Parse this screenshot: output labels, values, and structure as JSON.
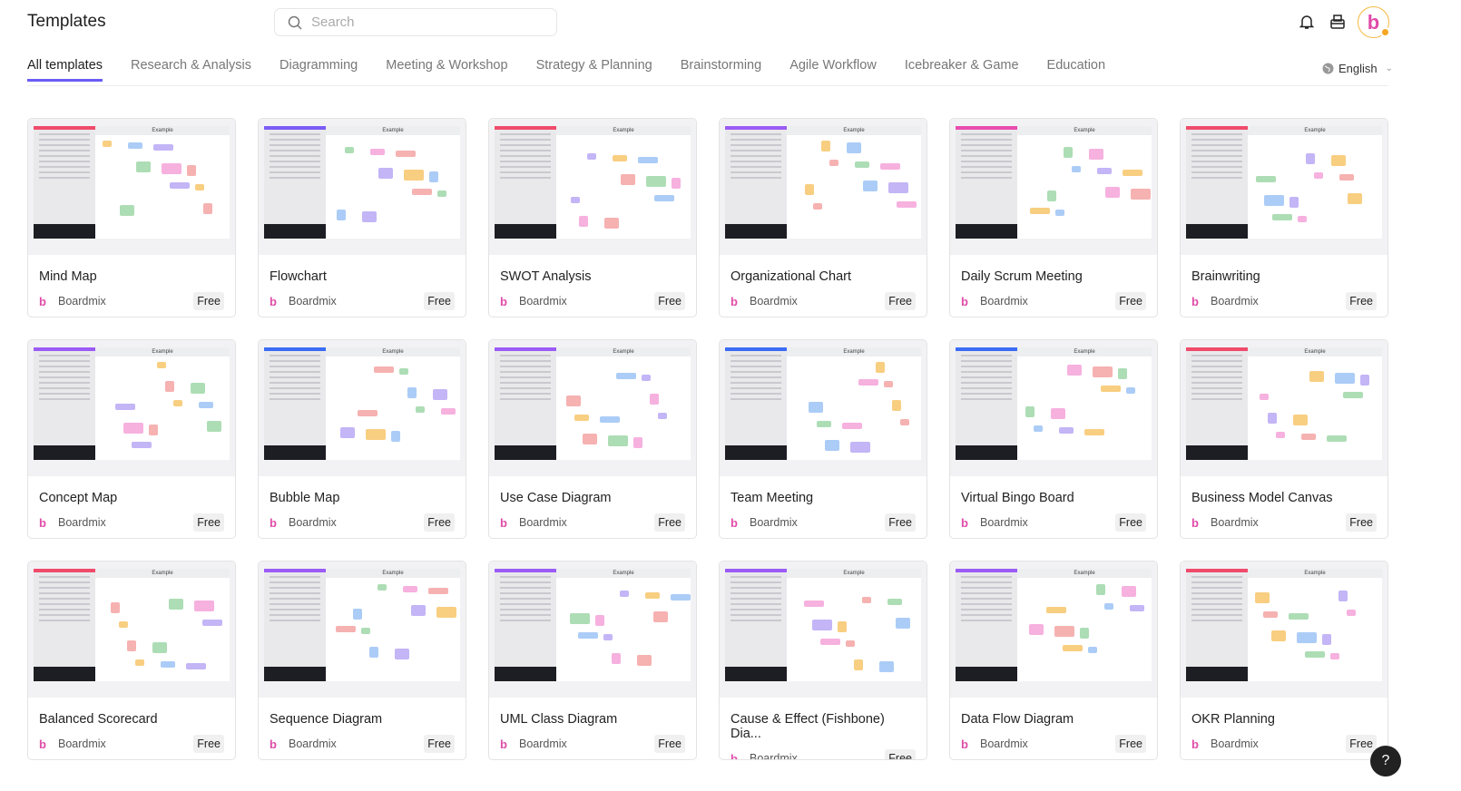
{
  "header": {
    "title": "Templates",
    "search_placeholder": "Search",
    "avatar_letter": "b"
  },
  "tabs": [
    "All templates",
    "Research & Analysis",
    "Diagramming",
    "Meeting & Workshop",
    "Strategy & Planning",
    "Brainstorming",
    "Agile Workflow",
    "Icebreaker & Game",
    "Education"
  ],
  "language": "English",
  "thumb_header": "Example",
  "templates": [
    {
      "title": "Mind Map",
      "author": "Boardmix",
      "price": "Free",
      "accent": "#f04b6b"
    },
    {
      "title": "Flowchart",
      "author": "Boardmix",
      "price": "Free",
      "accent": "#7b5cf5"
    },
    {
      "title": "SWOT Analysis",
      "author": "Boardmix",
      "price": "Free",
      "accent": "#f04b6b"
    },
    {
      "title": "Organizational Chart",
      "author": "Boardmix",
      "price": "Free",
      "accent": "#9b5cf5"
    },
    {
      "title": "Daily Scrum Meeting",
      "author": "Boardmix",
      "price": "Free",
      "accent": "#e94bb0"
    },
    {
      "title": "Brainwriting",
      "author": "Boardmix",
      "price": "Free",
      "accent": "#f04b6b"
    },
    {
      "title": "Concept Map",
      "author": "Boardmix",
      "price": "Free",
      "accent": "#9b5cf5"
    },
    {
      "title": "Bubble Map",
      "author": "Boardmix",
      "price": "Free",
      "accent": "#3b6cf5"
    },
    {
      "title": "Use Case Diagram",
      "author": "Boardmix",
      "price": "Free",
      "accent": "#9b5cf5"
    },
    {
      "title": "Team Meeting",
      "author": "Boardmix",
      "price": "Free",
      "accent": "#3b6cf5"
    },
    {
      "title": "Virtual Bingo Board",
      "author": "Boardmix",
      "price": "Free",
      "accent": "#3b6cf5"
    },
    {
      "title": "Business Model Canvas",
      "author": "Boardmix",
      "price": "Free",
      "accent": "#f04b6b"
    },
    {
      "title": "Balanced Scorecard",
      "author": "Boardmix",
      "price": "Free",
      "accent": "#f04b6b"
    },
    {
      "title": "Sequence Diagram",
      "author": "Boardmix",
      "price": "Free",
      "accent": "#9b5cf5"
    },
    {
      "title": "UML Class Diagram",
      "author": "Boardmix",
      "price": "Free",
      "accent": "#9b5cf5"
    },
    {
      "title": "Cause & Effect (Fishbone) Dia...",
      "author": "Boardmix",
      "price": "Free",
      "accent": "#9b5cf5"
    },
    {
      "title": "Data Flow Diagram",
      "author": "Boardmix",
      "price": "Free",
      "accent": "#9b5cf5"
    },
    {
      "title": "OKR Planning",
      "author": "Boardmix",
      "price": "Free",
      "accent": "#f04b6b"
    }
  ],
  "help_label": "?"
}
